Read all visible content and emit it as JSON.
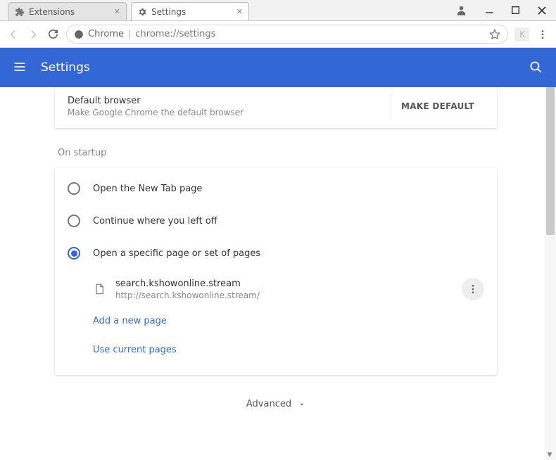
{
  "window": {
    "tabs": [
      {
        "label": "Extensions",
        "active": false
      },
      {
        "label": "Settings",
        "active": true
      }
    ],
    "address": {
      "scheme_label": "Chrome",
      "url": "chrome://settings"
    },
    "ext_badge": "K"
  },
  "header": {
    "title": "Settings"
  },
  "default_browser": {
    "title": "Default browser",
    "subtitle": "Make Google Chrome the default browser",
    "button": "MAKE DEFAULT"
  },
  "startup": {
    "section_label": "On startup",
    "options": [
      "Open the New Tab page",
      "Continue where you left off",
      "Open a specific page or set of pages"
    ],
    "selected_index": 2,
    "page": {
      "title": "search.kshowonline.stream",
      "url": "http://search.kshowonline.stream/"
    },
    "add_link": "Add a new page",
    "use_link": "Use current pages"
  },
  "advanced_label": "Advanced"
}
